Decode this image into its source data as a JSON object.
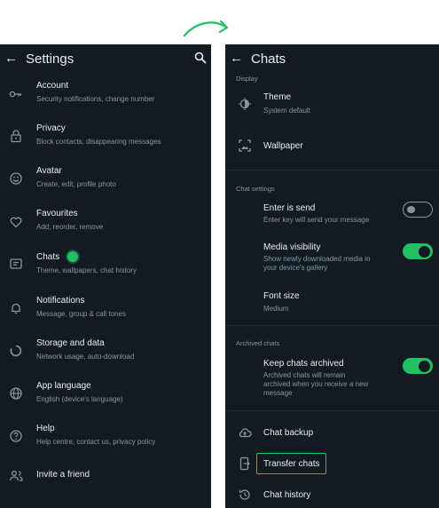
{
  "left": {
    "title": "Settings",
    "items": [
      {
        "label": "Account",
        "sub": "Security notifications, change number",
        "icon": "key-icon"
      },
      {
        "label": "Privacy",
        "sub": "Block contacts, disappearing messages",
        "icon": "lock-icon"
      },
      {
        "label": "Avatar",
        "sub": "Create, edit, profile photo",
        "icon": "avatar-icon"
      },
      {
        "label": "Favourites",
        "sub": "Add, reorder, remove",
        "icon": "heart-icon"
      },
      {
        "label": "Chats",
        "sub": "Theme, wallpapers, chat history",
        "icon": "chat-icon"
      },
      {
        "label": "Notifications",
        "sub": "Message, group & call tones",
        "icon": "bell-icon"
      },
      {
        "label": "Storage and data",
        "sub": "Network usage, auto-download",
        "icon": "storage-icon"
      },
      {
        "label": "App language",
        "sub": "English (device's language)",
        "icon": "globe-icon"
      },
      {
        "label": "Help",
        "sub": "Help centre, contact us, privacy policy",
        "icon": "help-icon"
      },
      {
        "label": "Invite a friend",
        "sub": "",
        "icon": "people-icon"
      }
    ]
  },
  "right": {
    "title": "Chats",
    "sections": {
      "display": "Display",
      "chat_settings": "Chat settings",
      "archived": "Archived chats"
    },
    "theme": {
      "label": "Theme",
      "sub": "System default"
    },
    "wallpaper": {
      "label": "Wallpaper"
    },
    "enter_send": {
      "label": "Enter is send",
      "sub": "Enter key will send your message",
      "on": false
    },
    "media": {
      "label": "Media visibility",
      "sub1": "Show newly downloaded media in",
      "sub2": "your device's gallery",
      "on": true
    },
    "font": {
      "label": "Font size",
      "sub": "Medium"
    },
    "archive": {
      "label": "Keep chats archived",
      "sub1": "Archived chats will remain",
      "sub2": "archived when you receive a new",
      "sub3": "message",
      "on": true
    },
    "backup": {
      "label": "Chat backup"
    },
    "transfer": {
      "label": "Transfer chats"
    },
    "history": {
      "label": "Chat history"
    }
  },
  "colors": {
    "accent": "#21c063",
    "background": "#121b22",
    "text": "#e9edef",
    "secondary": "#8696a0"
  }
}
